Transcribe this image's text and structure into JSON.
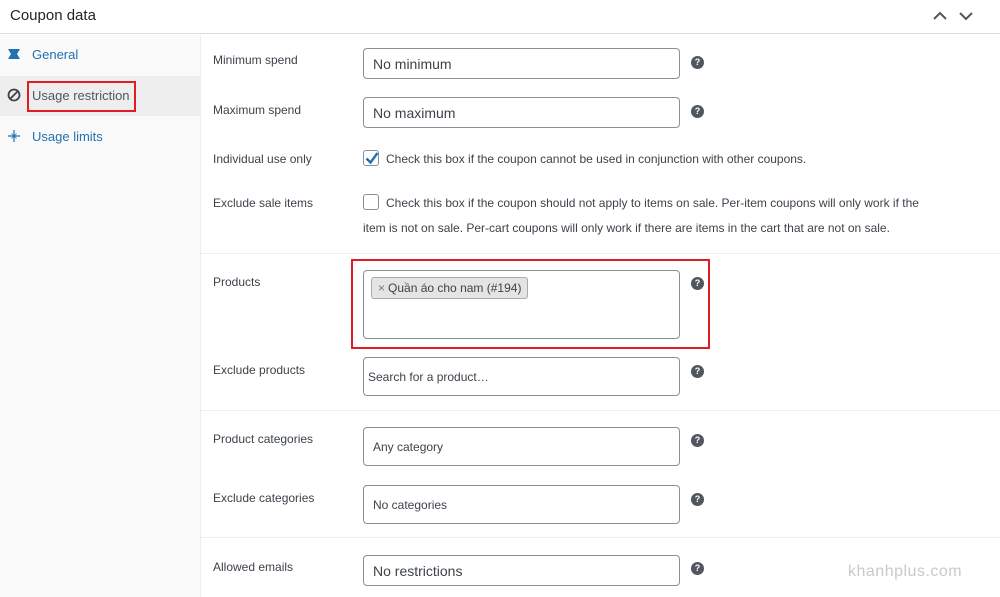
{
  "header": {
    "title": "Coupon data"
  },
  "sidebar": {
    "items": [
      {
        "label": "General",
        "icon": "ticket-icon",
        "active": false
      },
      {
        "label": "Usage restriction",
        "icon": "block-icon",
        "active": true
      },
      {
        "label": "Usage limits",
        "icon": "plus-sparkle-icon",
        "active": false
      }
    ]
  },
  "fields": {
    "minimum_spend": {
      "label": "Minimum spend",
      "placeholder": "No minimum"
    },
    "maximum_spend": {
      "label": "Maximum spend",
      "placeholder": "No maximum"
    },
    "individual_use": {
      "label": "Individual use only",
      "checked": true,
      "description": "Check this box if the coupon cannot be used in conjunction with other coupons."
    },
    "exclude_sale": {
      "label": "Exclude sale items",
      "checked": false,
      "description_line1": "Check this box if the coupon should not apply to items on sale. Per-item coupons will only work if the",
      "description_line2": "item is not on sale. Per-cart coupons will only work if there are items in the cart that are not on sale."
    },
    "products": {
      "label": "Products",
      "chip_remove": "×",
      "selected": [
        "Quần áo cho nam (#194)"
      ]
    },
    "exclude_products": {
      "label": "Exclude products",
      "placeholder": "Search for a product…"
    },
    "product_categories": {
      "label": "Product categories",
      "placeholder": "Any category"
    },
    "exclude_categories": {
      "label": "Exclude categories",
      "placeholder": "No categories"
    },
    "allowed_emails": {
      "label": "Allowed emails",
      "placeholder": "No restrictions"
    }
  },
  "help_glyph": "?",
  "watermark": "khanhplus.com",
  "colors": {
    "link": "#2271b1",
    "highlight": "#e31b23",
    "check": "#2271b1"
  }
}
